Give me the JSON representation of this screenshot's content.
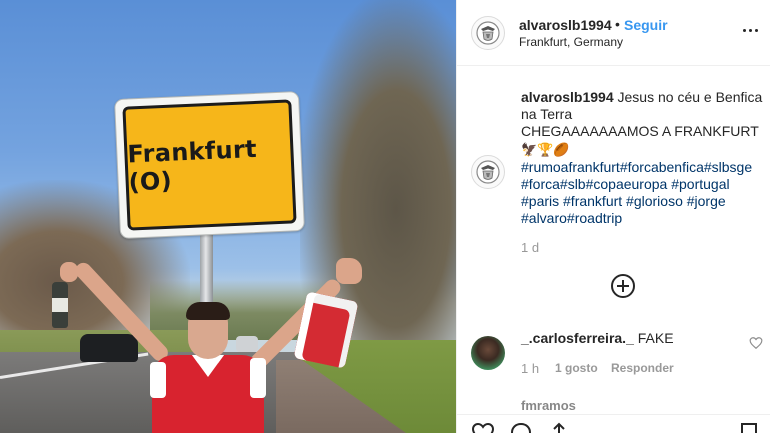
{
  "photo": {
    "sign_text": "Frankfurt (O)"
  },
  "header": {
    "username": "alvaroslb1994",
    "separator": "•",
    "follow_label": "Seguir",
    "location": "Frankfurt, Germany"
  },
  "caption": {
    "username": "alvaroslb1994",
    "text_line1": "Jesus no céu e Benfica na Terra",
    "text_line2": "CHEGAAAAAAAMOS A FRANKFURT",
    "emoji": "🦅🏆🏉",
    "hashtags": "#rumoafrankfurt#forcabenfica#slbsge #forca#slb#copaeuropa #portugal #paris #frankfurt #glorioso #jorge #alvaro#roadtrip",
    "time": "1 d"
  },
  "comment": {
    "username": "_.carlosferreira._",
    "text": "FAKE",
    "time": "1 h",
    "likes": "1 gosto",
    "reply_label": "Responder"
  },
  "next_comment": {
    "username": "fmramos_"
  },
  "colors": {
    "link_blue": "#3897f0",
    "hashtag": "#003569",
    "muted": "#999999"
  }
}
